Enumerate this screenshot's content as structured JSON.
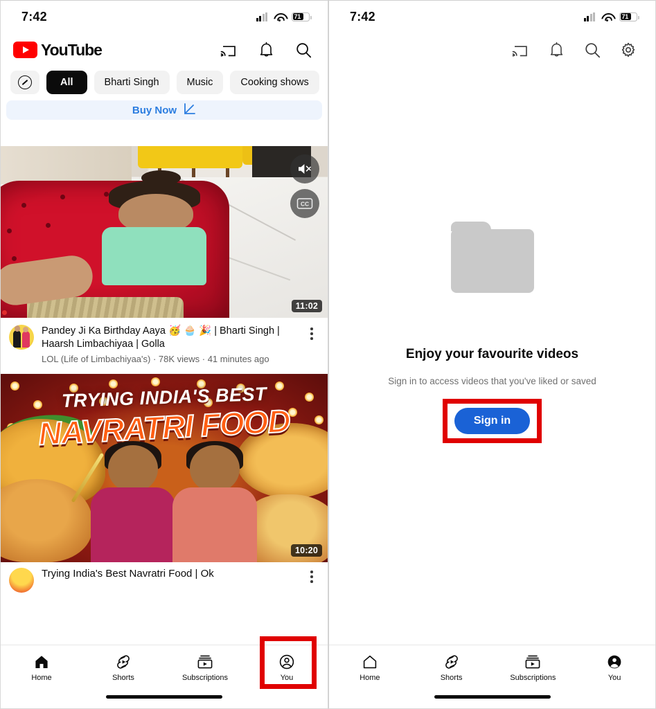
{
  "left_phone": {
    "status_bar": {
      "time": "7:42",
      "battery_level": "71",
      "signal_icon": "cellular-signal-icon",
      "wifi_icon": "wifi-icon",
      "battery_icon": "battery-icon"
    },
    "header": {
      "logo_text": "YouTube",
      "actions": [
        {
          "name": "cast-icon",
          "label": "Cast"
        },
        {
          "name": "notifications-bell-icon",
          "label": "Notifications"
        },
        {
          "name": "search-icon",
          "label": "Search"
        }
      ]
    },
    "chips": [
      {
        "label": "",
        "icon": "compass-explore-icon",
        "active": false
      },
      {
        "label": "All",
        "active": true
      },
      {
        "label": "Bharti Singh",
        "active": false
      },
      {
        "label": "Music",
        "active": false
      },
      {
        "label": "Cooking shows",
        "active": false
      }
    ],
    "ad_banner": {
      "label": "Buy Now",
      "icon": "external-link-icon"
    },
    "videos": [
      {
        "duration": "11:02",
        "title": "Pandey Ji Ka Birthday Aaya 🥳 🧁 🎉 | Bharti Singh | Haarsh Limbachiyaa | Golla",
        "meta": "LOL (Life of Limbachiyaa's) · 78K views · 41 minutes ago",
        "overlay_icons": [
          "mute-icon",
          "closed-captions-icon"
        ]
      },
      {
        "duration": "10:20",
        "thumbnail_text_line1": "TRYING INDIA'S BEST",
        "thumbnail_text_line2": "NAVRATRI FOOD",
        "title": "Trying India's Best Navratri Food | Ok"
      }
    ],
    "bottom_nav": [
      {
        "label": "Home",
        "icon": "home-icon",
        "active": true
      },
      {
        "label": "Shorts",
        "icon": "shorts-icon",
        "active": false
      },
      {
        "label": "Subscriptions",
        "icon": "subscriptions-icon",
        "active": false
      },
      {
        "label": "You",
        "icon": "account-circle-icon",
        "active": false,
        "highlighted": true
      }
    ]
  },
  "right_phone": {
    "status_bar": {
      "time": "7:42",
      "battery_level": "71"
    },
    "header": {
      "actions": [
        {
          "name": "cast-icon",
          "label": "Cast"
        },
        {
          "name": "notifications-bell-icon",
          "label": "Notifications"
        },
        {
          "name": "search-icon",
          "label": "Search"
        },
        {
          "name": "settings-gear-icon",
          "label": "Settings"
        }
      ]
    },
    "empty_state": {
      "icon": "folder-icon",
      "title": "Enjoy your favourite videos",
      "subtitle": "Sign in to access videos that you've liked or saved",
      "button_label": "Sign in",
      "button_color": "#1a62d6",
      "highlight_color": "#e00000"
    },
    "bottom_nav": [
      {
        "label": "Home",
        "icon": "home-icon",
        "active": false
      },
      {
        "label": "Shorts",
        "icon": "shorts-icon",
        "active": false
      },
      {
        "label": "Subscriptions",
        "icon": "subscriptions-icon",
        "active": false
      },
      {
        "label": "You",
        "icon": "account-circle-filled-icon",
        "active": true
      }
    ]
  }
}
